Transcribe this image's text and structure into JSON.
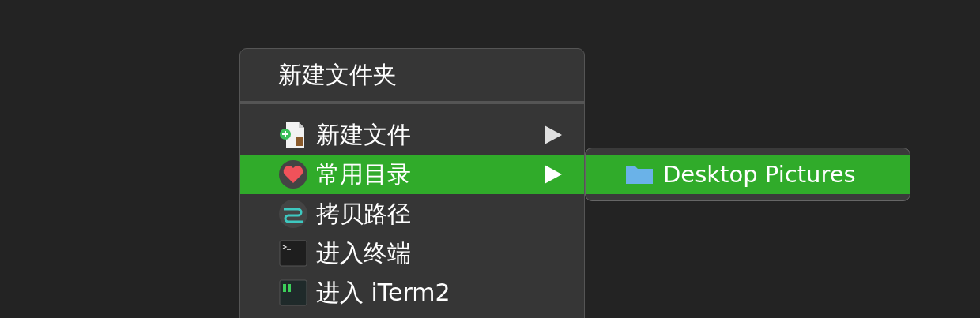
{
  "menu": {
    "top_item": {
      "label": "新建文件夹"
    },
    "items": [
      {
        "label": "新建文件",
        "kind": "file",
        "selected": false,
        "has_submenu": true
      },
      {
        "label": "常用目录",
        "kind": "heart",
        "selected": true,
        "has_submenu": true
      },
      {
        "label": "拷贝路径",
        "kind": "path",
        "selected": false,
        "has_submenu": false
      },
      {
        "label": "进入终端",
        "kind": "terminal",
        "selected": false,
        "has_submenu": false
      },
      {
        "label": "进入 iTerm2",
        "kind": "iterm",
        "selected": false,
        "has_submenu": false
      }
    ]
  },
  "submenu": {
    "items": [
      {
        "label": "Desktop Pictures",
        "selected": true
      }
    ]
  }
}
